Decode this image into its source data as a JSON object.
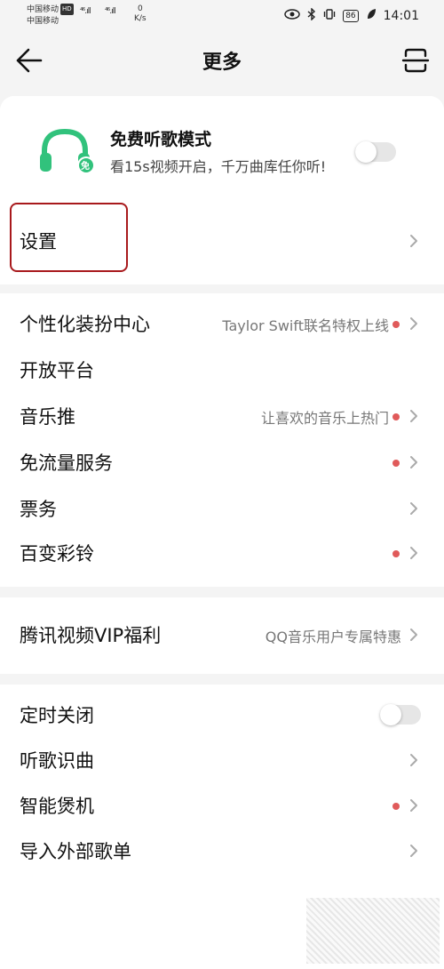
{
  "status": {
    "carrier1": "中国移动",
    "hd": "HD",
    "carrier2": "中国移动",
    "sig1": "⁴⁶.ıll",
    "sig2": "⁴⁶.ıll",
    "speed_val": "0",
    "speed_unit": "K/s",
    "battery": "86",
    "time": "14:01"
  },
  "header": {
    "title": "更多"
  },
  "promo": {
    "title": "免费听歌模式",
    "subtitle": "看15s视频开启，千万曲库任你听!",
    "badge": "免",
    "toggle_on": false
  },
  "settings": {
    "label": "设置"
  },
  "group2": [
    {
      "label": "个性化装扮中心",
      "hint": "Taylor Swift联名特权上线",
      "dot": true
    },
    {
      "label": "开放平台",
      "hint": "",
      "dot": false
    },
    {
      "label": "音乐推",
      "hint": "让喜欢的音乐上热门",
      "dot": true
    },
    {
      "label": "免流量服务",
      "hint": "",
      "dot": true
    },
    {
      "label": "票务",
      "hint": "",
      "dot": false
    },
    {
      "label": "百变彩铃",
      "hint": "",
      "dot": true
    }
  ],
  "group3": {
    "label": "腾讯视频VIP福利",
    "hint": "QQ音乐用户专属特惠"
  },
  "group4": [
    {
      "label": "定时关闭",
      "type": "toggle",
      "on": false
    },
    {
      "label": "听歌识曲",
      "type": "chevron"
    },
    {
      "label": "智能煲机",
      "type": "chevron",
      "dot": true
    },
    {
      "label": "导入外部歌单",
      "type": "chevron"
    }
  ],
  "colors": {
    "accent_green": "#31c27c",
    "dot_red": "#e05a5a",
    "highlight_red": "#a8191c"
  }
}
